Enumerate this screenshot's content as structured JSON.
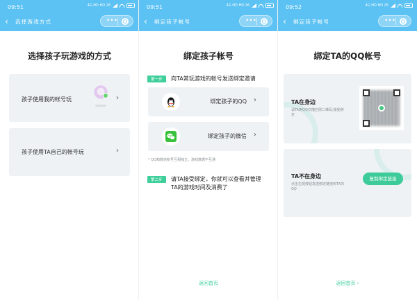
{
  "screens": [
    {
      "status": {
        "time": "09:51",
        "icons_text": "4G HD HD 26"
      },
      "nav": {
        "title": "选择游戏方式"
      },
      "heading": "选择孩子玩游戏的方式",
      "options": [
        {
          "label": "孩子使用我的帐号玩",
          "arrow": "›"
        },
        {
          "label": "孩子使用TA自己的帐号玩",
          "arrow": "›"
        }
      ]
    },
    {
      "status": {
        "time": "09:51",
        "icons_text": "4G HD HD 26"
      },
      "nav": {
        "title": "绑定孩子帐号"
      },
      "heading": "绑定孩子帐号",
      "step1": {
        "badge": "第一步",
        "text": "向TA常玩游戏的帐号发送绑定邀请"
      },
      "bind_qq": {
        "label": "绑定孩子的QQ",
        "arrow": "›"
      },
      "bind_wechat": {
        "label": "绑定孩子的微信",
        "arrow": "›"
      },
      "note": "* QQ和微信帐号互相独立，游戏数据不互通",
      "step2": {
        "badge": "第二步",
        "line1": "请TA接受绑定，你就可以查看并管理",
        "line2": "TA的游戏时间及消费了"
      },
      "home_link": "返回首页"
    },
    {
      "status": {
        "time": "09:52",
        "icons_text": "4G HD HD 25"
      },
      "nav": {
        "title": "绑定孩子帐号"
      },
      "heading": "绑定TA的QQ帐号",
      "present": {
        "title": "TA在身边",
        "desc": "请TA用QQ扫描右侧二维码,接受绑定"
      },
      "absent": {
        "title": "TA不在身边",
        "desc": "点击右侧按钮发送绑定链接到TA的QQ",
        "button": "复制绑定链接"
      },
      "home_link": "返回首页 ›"
    }
  ],
  "colors": {
    "header": "#5cc2f3",
    "accent": "#3ecb9a",
    "card": "#eef2f5"
  },
  "icons": [
    "back-arrow-icon",
    "more-dots-icon",
    "close-circle-icon",
    "qq-penguin-icon",
    "wechat-icon",
    "qr-code"
  ]
}
